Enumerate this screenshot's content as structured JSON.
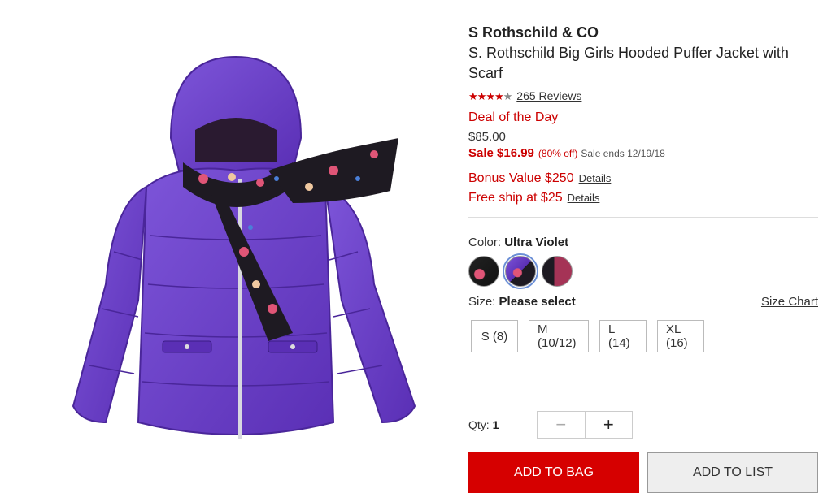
{
  "product": {
    "brand": "S Rothschild & CO",
    "title": "S. Rothschild Big Girls Hooded Puffer Jacket with Scarf",
    "rating": 4.6,
    "reviews_label": "265 Reviews",
    "deal_label": "Deal of the Day",
    "original_price": "$85.00",
    "sale_price": "Sale $16.99",
    "sale_percent": "(80% off)",
    "sale_ends": "Sale ends 12/19/18",
    "bonus_label": "Bonus Value $250",
    "ship_label": "Free ship at $25",
    "details_link": "Details"
  },
  "color": {
    "label": "Color:",
    "selected": "Ultra Violet",
    "swatches": [
      "black-floral",
      "ultra-violet",
      "burgundy"
    ],
    "accent": "#6b8fd6"
  },
  "size": {
    "label": "Size:",
    "selected": "Please select",
    "chart_link": "Size Chart",
    "options": [
      "S (8)",
      "M (10/12)",
      "L (14)",
      "XL (16)"
    ]
  },
  "quantity": {
    "label": "Qty:",
    "value": "1",
    "minus": "−",
    "plus": "+"
  },
  "actions": {
    "add_to_bag": "ADD TO BAG",
    "add_to_list": "ADD TO LIST"
  },
  "colors": {
    "sale_red": "#cc0000",
    "button_red": "#d60000",
    "jacket_purple": "#6a3fc6"
  }
}
